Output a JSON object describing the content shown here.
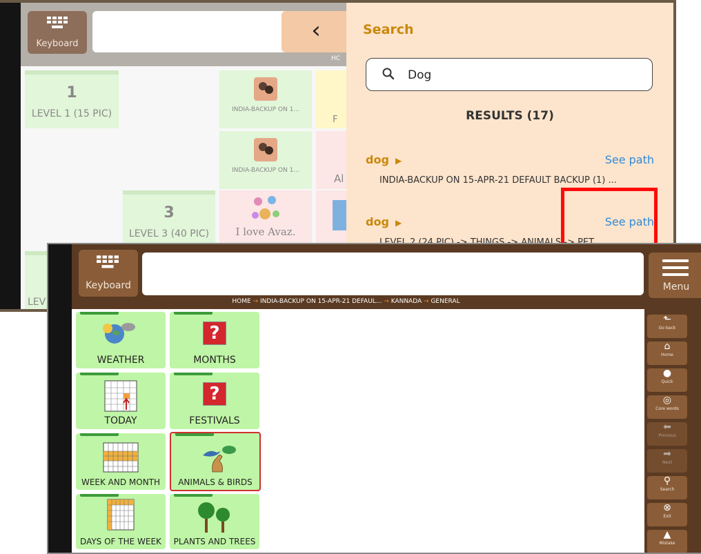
{
  "back_screen": {
    "keyboard_label": "Keyboard",
    "breadcrumb_fragment": "HC",
    "level_tiles": [
      {
        "number": "1",
        "label": "LEVEL 1 (15 PIC)"
      },
      {
        "number": "3",
        "label": "LEVEL 3 (40 PIC)"
      },
      {
        "number": "",
        "label": "LEV"
      }
    ],
    "photo_tiles": [
      "INDIA-BACKUP ON 1...",
      "INDIA-BACKUP ON 1..."
    ],
    "love_tile": "I love Avaz.",
    "partial_tiles": [
      "F",
      "Al"
    ],
    "search_panel": {
      "title": "Search",
      "query": "Dog",
      "results_heading": "RESULTS (17)",
      "results": [
        {
          "word": "dog",
          "path": "INDIA-BACKUP ON 15-APR-21 DEFAULT BACKUP (1) ...",
          "see_path": "See path"
        },
        {
          "word": "dog",
          "path": "LEVEL 2 (24 PIC) -> THINGS -> ANIMALS -> PET ...",
          "see_path": "See path"
        }
      ]
    }
  },
  "front_screen": {
    "keyboard_label": "Keyboard",
    "menu_label": "Menu",
    "breadcrumb": [
      "HOME",
      "INDIA-BACKUP ON 15-APR-21 DEFAUL...",
      "KANNADA",
      "GENERAL"
    ],
    "tiles": [
      {
        "label": "WEATHER",
        "icon": "weather-icon"
      },
      {
        "label": "MONTHS",
        "icon": "question-mark-icon"
      },
      {
        "label": "TODAY",
        "icon": "calendar-today-icon"
      },
      {
        "label": "FESTIVALS",
        "icon": "question-mark-icon"
      },
      {
        "label": "WEEK AND MONTH",
        "icon": "calendar-icon"
      },
      {
        "label": "ANIMALS & BIRDS",
        "icon": "animals-birds-icon"
      },
      {
        "label": "DAYS OF THE WEEK",
        "icon": "days-of-week-icon"
      },
      {
        "label": "PLANTS AND TREES",
        "icon": "trees-icon"
      }
    ],
    "question_mark": "?",
    "side_buttons": [
      {
        "label": "Go back",
        "icon": "go-back-icon"
      },
      {
        "label": "Home",
        "icon": "home-icon"
      },
      {
        "label": "Quick",
        "icon": "quick-speak-icon"
      },
      {
        "label": "Core words",
        "icon": "core-words-icon"
      },
      {
        "label": "Previous",
        "icon": "previous-icon"
      },
      {
        "label": "Next",
        "icon": "next-icon"
      },
      {
        "label": "Search",
        "icon": "search-icon"
      },
      {
        "label": "Exit",
        "icon": "exit-icon"
      },
      {
        "label": "Mistake",
        "icon": "mistake-icon"
      }
    ]
  },
  "colors": {
    "accent_orange": "#c8880c",
    "link_blue": "#2f8ad8",
    "tile_green": "#bff5a6",
    "toolbar_brown": "#8a5d38",
    "highlight_red": "#ff0a0a"
  }
}
